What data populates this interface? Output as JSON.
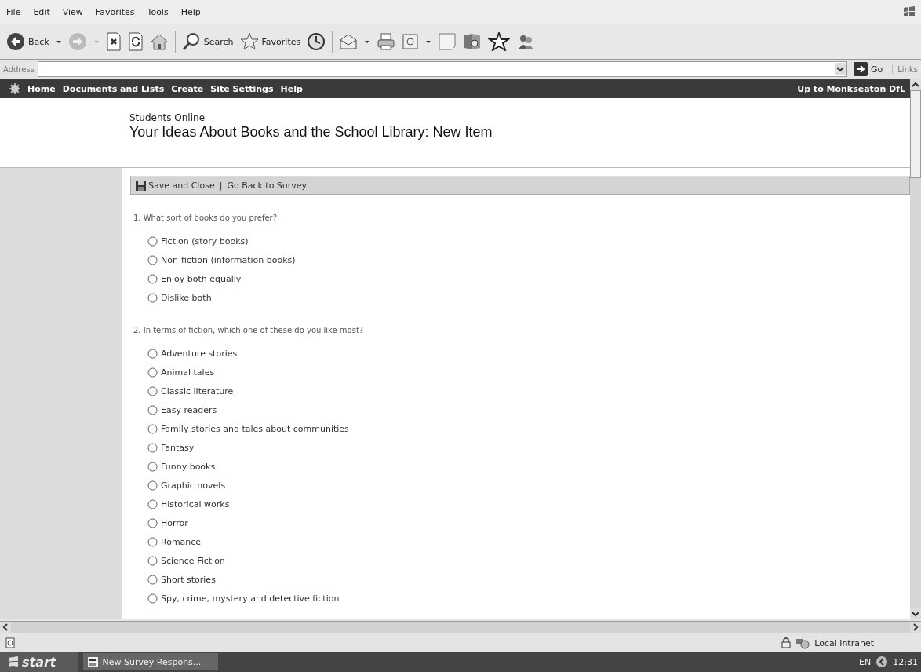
{
  "menu": [
    "File",
    "Edit",
    "View",
    "Favorites",
    "Tools",
    "Help"
  ],
  "toolbar": {
    "back": "Back",
    "search": "Search",
    "favorites": "Favorites"
  },
  "address_bar": {
    "label": "Address",
    "go": "Go",
    "links": "Links"
  },
  "nav": {
    "items": [
      "Home",
      "Documents and Lists",
      "Create",
      "Site Settings",
      "Help"
    ],
    "up_link": "Up to Monkseaton DfL"
  },
  "header": {
    "site": "Students Online",
    "title": "Your Ideas About Books and the School Library: New Item"
  },
  "actions": {
    "save": "Save and Close",
    "separator": "|",
    "back": "Go Back to Survey"
  },
  "questions": [
    {
      "text": "1. What sort of books do you prefer?",
      "options": [
        {
          "label": "Fiction (story books)",
          "selected": false
        },
        {
          "label": "Non-fiction (information books)",
          "selected": false
        },
        {
          "label": "Enjoy both equally",
          "selected": false
        },
        {
          "label": "Dislike both",
          "selected": false
        }
      ]
    },
    {
      "text": "2. In terms of fiction, which one of these do you like most?",
      "options": [
        {
          "label": "Adventure stories",
          "selected": false
        },
        {
          "label": "Animal tales",
          "selected": false
        },
        {
          "label": "Classic literature",
          "selected": false
        },
        {
          "label": "Easy readers",
          "selected": false
        },
        {
          "label": "Family stories and tales about communities",
          "selected": false
        },
        {
          "label": "Fantasy",
          "selected": false
        },
        {
          "label": "Funny books",
          "selected": false
        },
        {
          "label": "Graphic novels",
          "selected": false
        },
        {
          "label": "Historical works",
          "selected": false
        },
        {
          "label": "Horror",
          "selected": false
        },
        {
          "label": "Romance",
          "selected": false
        },
        {
          "label": "Science Fiction",
          "selected": false
        },
        {
          "label": "Short stories",
          "selected": false
        },
        {
          "label": "Spy, crime, mystery and detective fiction",
          "selected": false
        }
      ]
    }
  ],
  "status_bar": {
    "zone": "Local intranet"
  },
  "taskbar": {
    "start": "start",
    "task": "New Survey Respons...",
    "language": "EN",
    "clock": "12:31"
  }
}
